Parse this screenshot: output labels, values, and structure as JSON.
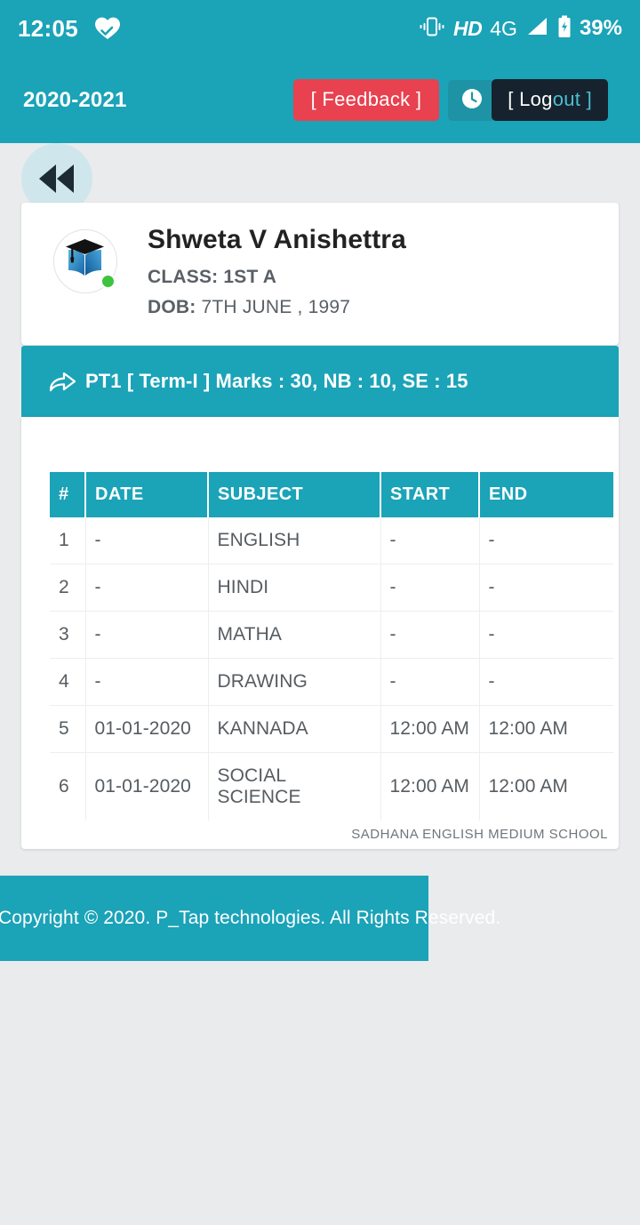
{
  "statusbar": {
    "time": "12:05",
    "heart_icon": "heart-check-icon",
    "vibrate_icon": "vibrate-icon",
    "hd": "HD",
    "network": "4G",
    "signal_icon": "signal-bars-icon",
    "battery_icon": "battery-charging-icon",
    "battery": "39%"
  },
  "appbar": {
    "year": "2020-2021",
    "feedback_label": "[ Feedback ]",
    "clock_icon": "clock-icon",
    "logout_label_main": "[ Log",
    "logout_label_tail": "out ]"
  },
  "back": {
    "icon": "rewind-back-icon"
  },
  "profile": {
    "avatar_icon": "graduation-book-avatar-icon",
    "status_dot": "online-status-dot",
    "name": "Shweta V Anishettra",
    "class_label": "CLASS: 1ST A",
    "dob_label": "DOB:",
    "dob_value": "7TH JUNE , 1997"
  },
  "section": {
    "share_icon": "share-arrow-icon",
    "title": "PT1 [ Term-I ] Marks : 30, NB : 10, SE : 15"
  },
  "table": {
    "columns": [
      "#",
      "DATE",
      "SUBJECT",
      "START",
      "END"
    ],
    "rows": [
      [
        "1",
        "-",
        "ENGLISH",
        "-",
        "-"
      ],
      [
        "2",
        "-",
        "HINDI",
        "-",
        "-"
      ],
      [
        "3",
        "-",
        "MATHA",
        "-",
        "-"
      ],
      [
        "4",
        "-",
        "DRAWING",
        "-",
        "-"
      ],
      [
        "5",
        "01-01-2020",
        "KANNADA",
        "12:00 AM",
        "12:00 AM"
      ],
      [
        "6",
        "01-01-2020",
        "SOCIAL SCIENCE",
        "12:00 AM",
        "12:00 AM"
      ]
    ],
    "school_name": "SADHANA ENGLISH MEDIUM SCHOOL"
  },
  "footer": {
    "copyright": "Copyright © 2020. P_Tap technologies. All Rights Reserved."
  },
  "colors": {
    "teal": "#1ba3b8",
    "red": "#e8414f",
    "dark": "#16222e",
    "page_bg": "#e9ebed",
    "green_dot": "#3cc43c"
  }
}
